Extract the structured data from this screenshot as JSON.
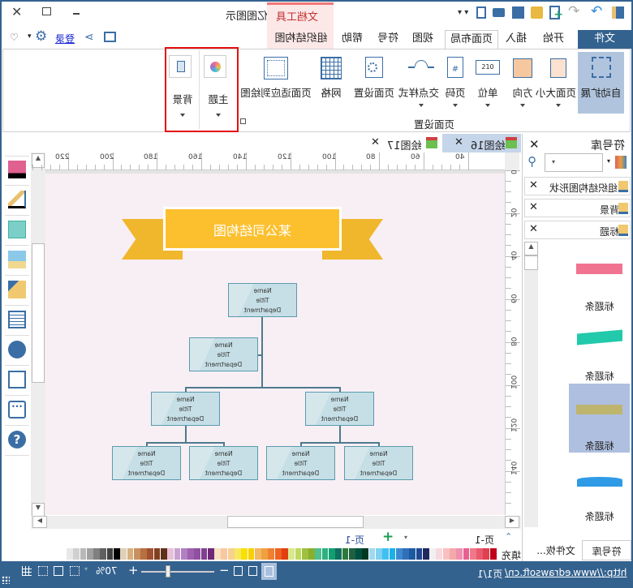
{
  "window": {
    "title": "亿图图示",
    "context_tab_group": "文档工具",
    "login": "登录"
  },
  "tabs": [
    {
      "label": "文件"
    },
    {
      "label": "开始"
    },
    {
      "label": "插入"
    },
    {
      "label": "页面布局",
      "active": true
    },
    {
      "label": "视图"
    },
    {
      "label": "符号"
    },
    {
      "label": "帮助"
    },
    {
      "label": "组织结构图"
    }
  ],
  "ribbon": {
    "group_label": "页面设置",
    "buttons": [
      {
        "label": "自动扩展",
        "active": true
      },
      {
        "label": "页面大小"
      },
      {
        "label": "方向"
      },
      {
        "label": "单位"
      },
      {
        "label": "页码"
      },
      {
        "label": "交点样式"
      },
      {
        "label": "页面设置"
      },
      {
        "label": "网格"
      },
      {
        "label": "页面适应到绘图"
      }
    ],
    "highlighted": [
      {
        "label": "主题"
      },
      {
        "label": "背景"
      }
    ]
  },
  "doc_tabs": [
    {
      "label": "绘图16",
      "active": true
    },
    {
      "label": "绘图17"
    }
  ],
  "ruler": {
    "h": [
      "40",
      "60",
      "80",
      "100",
      "120",
      "140",
      "160",
      "180",
      "200",
      "220"
    ],
    "v": [
      "0",
      "20",
      "40",
      "60",
      "80",
      "100",
      "120",
      "140"
    ]
  },
  "diagram": {
    "title": "某公司结构图",
    "box": {
      "name": "Name",
      "title": "Title",
      "dept": "Department"
    }
  },
  "library": {
    "title": "符号库",
    "categories": [
      {
        "label": "组织结构图形状"
      },
      {
        "label": "背景"
      },
      {
        "label": "标题"
      }
    ],
    "items": [
      {
        "label": "标题条",
        "color": "#f0738f"
      },
      {
        "label": "标题条",
        "color": "#22c9aa"
      },
      {
        "label": "标题条",
        "color": "#bdb46e",
        "selected": true
      },
      {
        "label": "标题条",
        "color": "#2f9be6"
      }
    ],
    "bottom_tabs": [
      {
        "label": "符号库"
      },
      {
        "label": "文件恢..."
      }
    ]
  },
  "pages": {
    "current": "页-1",
    "tab": "页-1"
  },
  "fill_label": "填充",
  "palette": [
    "#c00018",
    "#e04050",
    "#e85a6e",
    "#f07888",
    "#e86090",
    "#f090b0",
    "#f4a8a8",
    "#f8c0c0",
    "#f8d8e0",
    "#f0f0f0",
    "#202860",
    "#204890",
    "#1a5aa0",
    "#3070b8",
    "#3e8ad0",
    "#1ab0e8",
    "#40c0f0",
    "#80d0f0",
    "#a0d8f0",
    "#003820",
    "#005040",
    "#206040",
    "#2e7a3a",
    "#107060",
    "#10a070",
    "#30b080",
    "#50c090",
    "#88b030",
    "#a0c040",
    "#c0d860",
    "#d8e890",
    "#e04010",
    "#f06020",
    "#f08030",
    "#f0a040",
    "#f0b860",
    "#f8d000",
    "#f8e000",
    "#f8e860",
    "#f8d090",
    "#f8c8a0",
    "#f8e0c0",
    "#702878",
    "#804090",
    "#9050a0",
    "#a060b0",
    "#b080c0",
    "#c8a0d0",
    "#e8c0d8",
    "#603018",
    "#804020",
    "#a05030",
    "#b87040",
    "#c89060",
    "#d8b080",
    "#e0d0b8",
    "#000000",
    "#404040",
    "#606060",
    "#808080",
    "#a0a0a0",
    "#b8b8b8",
    "#d0d0d0",
    "#e8e8e8"
  ],
  "status": {
    "url": "http://www.edrawsoft.cn/",
    "page": "页1/1",
    "zoom": "70%",
    "zoom_level": 0.7
  },
  "colors": {
    "accent": "#34628f",
    "selected_tab_bg": "#c5d5ea",
    "highlight": "#e41010",
    "banner": "#fcc02e"
  }
}
